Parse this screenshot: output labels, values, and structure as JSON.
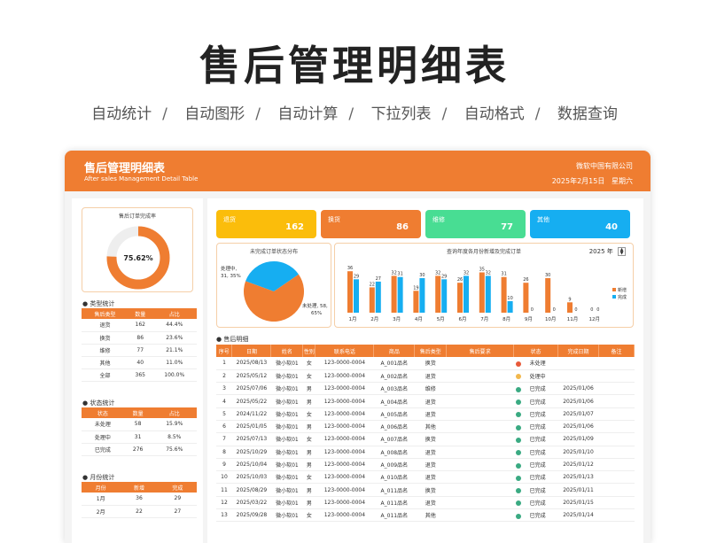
{
  "hero": {
    "title": "售后管理明细表",
    "features": [
      "自动统计",
      "自动图形",
      "自动计算",
      "下拉列表",
      "自动格式",
      "数据查询"
    ]
  },
  "header": {
    "title": "售后管理明细表",
    "subtitle": "After sales Management Detail Table",
    "company": "微软中国有限公司",
    "date": "2025年2月15日",
    "weekday": "星期六"
  },
  "colors": {
    "accent": "#ef7d31",
    "kpi_yellow": "#fbbd0b",
    "kpi_orange": "#ef7d31",
    "kpi_green": "#48dd93",
    "kpi_blue": "#16aef1",
    "done": "#3aaa82",
    "processing": "#f2b84d",
    "pending": "#e85a3a"
  },
  "completion": {
    "caption": "售后订单完成率",
    "value_label": "75.62%",
    "fraction": 0.7562
  },
  "type_stats": {
    "title": "类型统计",
    "headers": [
      "售后类型",
      "数量",
      "占比"
    ],
    "rows": [
      [
        "退货",
        "162",
        "44.4%"
      ],
      [
        "换货",
        "86",
        "23.6%"
      ],
      [
        "维修",
        "77",
        "21.1%"
      ],
      [
        "其他",
        "40",
        "11.0%"
      ],
      [
        "全部",
        "365",
        "100.0%"
      ]
    ]
  },
  "status_stats": {
    "title": "状态统计",
    "headers": [
      "状态",
      "数量",
      "占比"
    ],
    "rows": [
      [
        "未处理",
        "58",
        "15.9%"
      ],
      [
        "处理中",
        "31",
        "8.5%"
      ],
      [
        "已完成",
        "276",
        "75.6%"
      ]
    ]
  },
  "month_stats": {
    "title": "月份统计",
    "headers": [
      "月份",
      "新增",
      "完成"
    ],
    "rows": [
      [
        "1月",
        "36",
        "29"
      ],
      [
        "2月",
        "22",
        "27"
      ]
    ]
  },
  "kpis": [
    {
      "label": "退货",
      "value": "162",
      "color": "#fbbd0b"
    },
    {
      "label": "换货",
      "value": "86",
      "color": "#ef7d31"
    },
    {
      "label": "维修",
      "value": "77",
      "color": "#48dd93"
    },
    {
      "label": "其他",
      "value": "40",
      "color": "#16aef1"
    }
  ],
  "pie": {
    "caption": "未完成订单状态分布",
    "label_a_1": "处理中,",
    "label_a_2": "31, 35%",
    "label_b_1": "未处理, 58,",
    "label_b_2": "65%"
  },
  "bar": {
    "caption": "查询年度各月份新增及完成订单",
    "year": "2025",
    "year_unit": "年",
    "legend_new": "新增",
    "legend_done": "完成"
  },
  "chart_data": {
    "type": "bar",
    "title": "查询年度各月份新增及完成订单",
    "categories": [
      "1月",
      "2月",
      "3月",
      "4月",
      "5月",
      "6月",
      "7月",
      "8月",
      "9月",
      "10月",
      "11月",
      "12月"
    ],
    "series": [
      {
        "name": "新增",
        "values": [
          36,
          22,
          32,
          19,
          32,
          26,
          35,
          31,
          26,
          30,
          9,
          0
        ]
      },
      {
        "name": "完成",
        "values": [
          29,
          27,
          31,
          30,
          29,
          32,
          32,
          10,
          0,
          0,
          0,
          0
        ]
      }
    ],
    "ylim": [
      0,
      40
    ],
    "legend": "right"
  },
  "detail": {
    "title": "售后明细",
    "headers": [
      "序号",
      "日期",
      "姓名",
      "性别",
      "联系电话",
      "商品",
      "售后类型",
      "售后要求",
      "状态",
      "完成日期",
      "备注"
    ],
    "rows": [
      [
        "1",
        "2025/08/13",
        "微小软01",
        "女",
        "123-0000-0004",
        "A_001品名",
        "换货",
        "",
        "未处理",
        "",
        ""
      ],
      [
        "2",
        "2025/05/12",
        "微小软01",
        "女",
        "123-0000-0004",
        "A_002品名",
        "退货",
        "",
        "处理中",
        "",
        ""
      ],
      [
        "3",
        "2025/07/06",
        "微小软01",
        "男",
        "123-0000-0004",
        "A_003品名",
        "维修",
        "",
        "已完成",
        "2025/01/06",
        ""
      ],
      [
        "4",
        "2025/05/22",
        "微小软01",
        "男",
        "123-0000-0004",
        "A_004品名",
        "退货",
        "",
        "已完成",
        "2025/01/06",
        ""
      ],
      [
        "5",
        "2024/11/22",
        "微小软01",
        "女",
        "123-0000-0004",
        "A_005品名",
        "退货",
        "",
        "已完成",
        "2025/01/07",
        ""
      ],
      [
        "6",
        "2025/01/05",
        "微小软01",
        "男",
        "123-0000-0004",
        "A_006品名",
        "其他",
        "",
        "已完成",
        "2025/01/06",
        ""
      ],
      [
        "7",
        "2025/07/13",
        "微小软01",
        "女",
        "123-0000-0004",
        "A_007品名",
        "换货",
        "",
        "已完成",
        "2025/01/09",
        ""
      ],
      [
        "8",
        "2025/10/29",
        "微小软01",
        "男",
        "123-0000-0004",
        "A_008品名",
        "退货",
        "",
        "已完成",
        "2025/01/10",
        ""
      ],
      [
        "9",
        "2025/10/04",
        "微小软01",
        "男",
        "123-0000-0004",
        "A_009品名",
        "退货",
        "",
        "已完成",
        "2025/01/12",
        ""
      ],
      [
        "10",
        "2025/10/03",
        "微小软01",
        "女",
        "123-0000-0004",
        "A_010品名",
        "退货",
        "",
        "已完成",
        "2025/01/13",
        ""
      ],
      [
        "11",
        "2025/08/29",
        "微小软01",
        "男",
        "123-0000-0004",
        "A_011品名",
        "换货",
        "",
        "已完成",
        "2025/01/11",
        ""
      ],
      [
        "12",
        "2025/03/22",
        "微小软01",
        "男",
        "123-0000-0004",
        "A_011品名",
        "退货",
        "",
        "已完成",
        "2025/01/15",
        ""
      ],
      [
        "13",
        "2025/09/28",
        "微小软01",
        "女",
        "123-0000-0004",
        "A_011品名",
        "其他",
        "",
        "已完成",
        "2025/01/14",
        ""
      ]
    ]
  }
}
